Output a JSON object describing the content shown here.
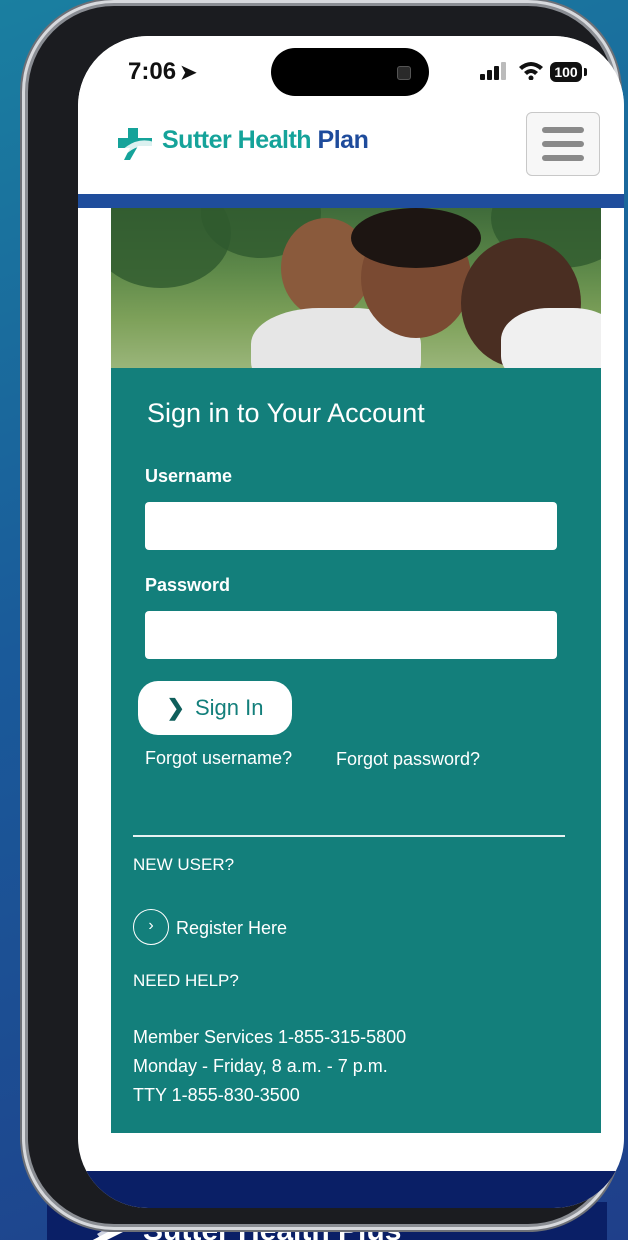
{
  "status_bar": {
    "time": "7:06",
    "battery": "100"
  },
  "header": {
    "brand_part1": "Sutter Health",
    "brand_part2": "Plan"
  },
  "colors": {
    "teal": "#137f7b",
    "brand_blue": "#1e4b9b",
    "brand_teal": "#15a39a",
    "footer_navy": "#0a1f66"
  },
  "signin": {
    "title": "Sign in to Your Account",
    "username_label": "Username",
    "username_value": "",
    "password_label": "Password",
    "password_value": "",
    "button_label": "Sign In",
    "forgot_username": "Forgot username?",
    "forgot_password": "Forgot password?"
  },
  "new_user": {
    "heading": "NEW USER?",
    "register_label": "Register Here"
  },
  "help": {
    "heading": "NEED HELP?",
    "line1": "Member Services 1-855-315-5800",
    "line2": "Monday - Friday, 8 a.m. - 7 p.m.",
    "line3": "TTY 1-855-830-3500"
  },
  "footer": {
    "brand": "Sutter Health Plus"
  },
  "icons": [
    "location-arrow-icon",
    "signal-icon",
    "wifi-icon",
    "battery-icon",
    "hamburger-menu-icon",
    "chevron-right-icon",
    "circle-chevron-right-icon",
    "sutter-logo-icon"
  ]
}
